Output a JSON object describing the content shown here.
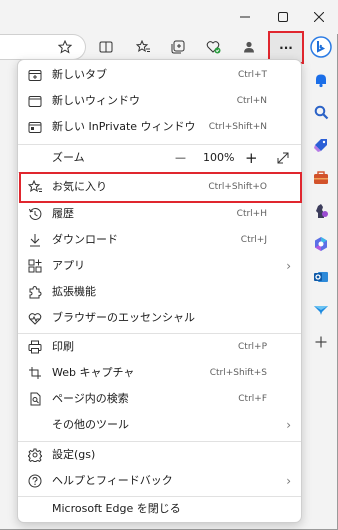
{
  "window": {
    "minimize_icon": "minimize-icon",
    "maximize_icon": "maximize-icon",
    "close_icon": "close-icon"
  },
  "toolbar": {
    "icons": [
      "star-outline-icon",
      "split-screen-icon",
      "favorites-icon",
      "collections-icon",
      "browser-essentials-icon",
      "profile-icon",
      "more-icon"
    ],
    "more_label": "···"
  },
  "sidebar": {
    "icons": [
      "bing-icon",
      "notification-icon",
      "search-icon",
      "shopping-tag-icon",
      "tools-icon",
      "games-icon",
      "copilot-icon",
      "outlook-icon",
      "drop-icon",
      "add-icon"
    ]
  },
  "menu": {
    "items": [
      {
        "label": "新しいタブ",
        "shortcut": "Ctrl+T",
        "icon": "new-tab-icon"
      },
      {
        "label": "新しいウィンドウ",
        "shortcut": "Ctrl+N",
        "icon": "new-window-icon"
      },
      {
        "label": "新しい InPrivate ウィンドウ",
        "shortcut": "Ctrl+Shift+N",
        "icon": "inprivate-icon"
      },
      {
        "label": "お気に入り",
        "shortcut": "Ctrl+Shift+O",
        "icon": "favorites-icon"
      },
      {
        "label": "履歴",
        "shortcut": "Ctrl+H",
        "icon": "history-icon"
      },
      {
        "label": "ダウンロード",
        "shortcut": "Ctrl+J",
        "icon": "download-icon"
      },
      {
        "label": "アプリ",
        "shortcut": "",
        "icon": "apps-icon"
      },
      {
        "label": "拡張機能",
        "shortcut": "",
        "icon": "extensions-icon"
      },
      {
        "label": "ブラウザーのエッセンシャル",
        "shortcut": "",
        "icon": "essentials-icon"
      },
      {
        "label": "印刷",
        "shortcut": "Ctrl+P",
        "icon": "print-icon"
      },
      {
        "label": "Web キャプチャ",
        "shortcut": "Ctrl+Shift+S",
        "icon": "web-capture-icon"
      },
      {
        "label": "ページ内の検索",
        "shortcut": "Ctrl+F",
        "icon": "find-icon"
      },
      {
        "label": "その他のツール",
        "shortcut": "",
        "icon": ""
      },
      {
        "label": "設定(gs)",
        "shortcut": "",
        "icon": "settings-icon"
      },
      {
        "label": "ヘルプとフィードバック",
        "shortcut": "",
        "icon": "help-icon"
      },
      {
        "label": "Microsoft Edge を閉じる",
        "shortcut": "",
        "icon": ""
      }
    ],
    "zoom": {
      "label": "ズーム",
      "minus": "—",
      "value": "100%",
      "plus": "+"
    },
    "arrow": "›"
  },
  "colors": {
    "highlight": "#e0262e",
    "background": "#f3f3f3",
    "menu_bg": "#ffffff"
  }
}
